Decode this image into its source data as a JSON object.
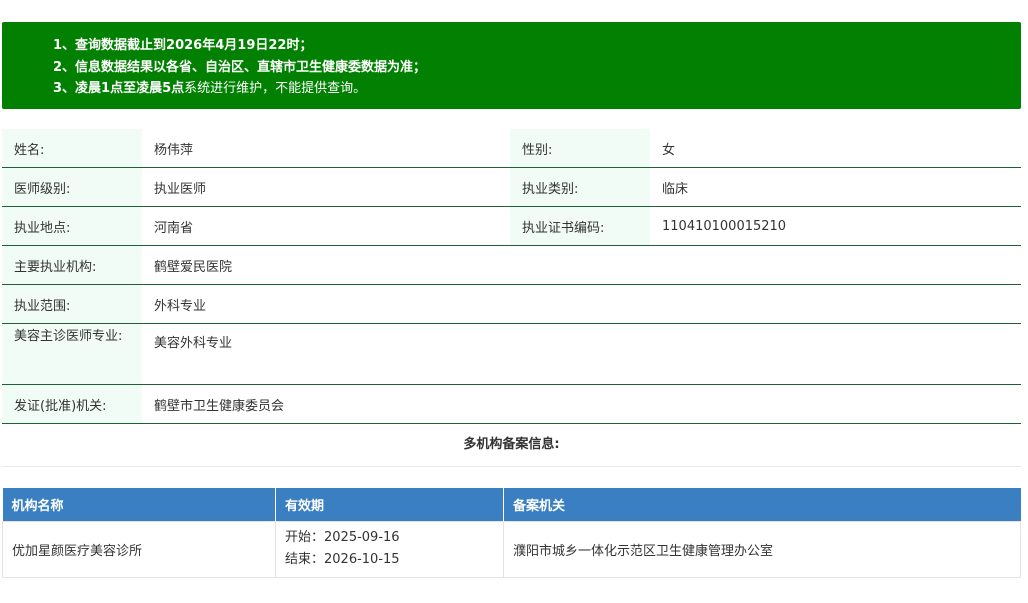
{
  "notice": {
    "line1_prefix": "1、",
    "line1_text": "查询数据截止到2026年4月19日22时；",
    "line2_prefix": "2、",
    "line2_text": "信息数据结果以各省、自治区、直辖市卫生健康委数据为准；",
    "line3_prefix": "3、",
    "line3_bold": "凌晨1点至凌晨5点",
    "line3_text": "系统进行维护，不能提供查询。"
  },
  "info": {
    "name_label": "姓名:",
    "name_value": "杨伟萍",
    "gender_label": "性别:",
    "gender_value": "女",
    "level_label": "医师级别:",
    "level_value": "执业医师",
    "category_label": "执业类别:",
    "category_value": "临床",
    "location_label": "执业地点:",
    "location_value": "河南省",
    "cert_label": "执业证书编码:",
    "cert_value": "110410100015210",
    "institution_label": "主要执业机构:",
    "institution_value": "鹤壁爱民医院",
    "scope_label": "执业范围:",
    "scope_value": "外科专业",
    "cosmetic_label": "美容主诊医师专业:",
    "cosmetic_value": "美容外科专业",
    "issuer_label": "发证(批准)机关:",
    "issuer_value": "鹤壁市卫生健康委员会"
  },
  "multi": {
    "title": "多机构备案信息:",
    "columns": [
      "机构名称",
      "有效期",
      "备案机关"
    ],
    "rows": [
      {
        "org": "优加星颜医疗美容诊所",
        "start": "开始：2025-09-16",
        "end": "结束：2026-10-15",
        "authority": "濮阳市城乡一体化示范区卫生健康管理办公室"
      }
    ]
  }
}
